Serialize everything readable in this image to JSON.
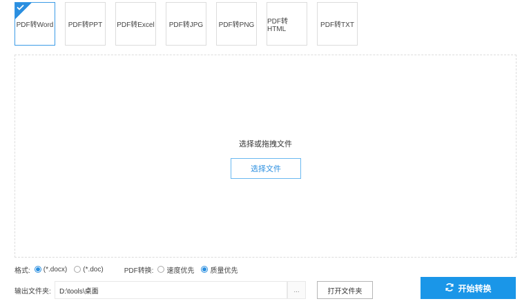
{
  "tabs": [
    {
      "label": "PDF转Word",
      "active": true
    },
    {
      "label": "PDF转PPT",
      "active": false
    },
    {
      "label": "PDF转Excel",
      "active": false
    },
    {
      "label": "PDF转JPG",
      "active": false
    },
    {
      "label": "PDF转PNG",
      "active": false
    },
    {
      "label": "PDF转HTML",
      "active": false
    },
    {
      "label": "PDF转TXT",
      "active": false
    }
  ],
  "dropzone": {
    "hint": "选择或拖拽文件",
    "select_button": "选择文件"
  },
  "format": {
    "label": "格式:",
    "options": [
      {
        "label": "(*.docx)",
        "checked": true
      },
      {
        "label": "(*.doc)",
        "checked": false
      }
    ]
  },
  "conversion": {
    "label": "PDF转换:",
    "options": [
      {
        "label": "速度优先",
        "checked": false
      },
      {
        "label": "质量优先",
        "checked": true
      }
    ]
  },
  "output": {
    "label": "输出文件夹:",
    "path": "D:\\tools\\桌面",
    "browse": "...",
    "open_folder": "打开文件夹"
  },
  "start_button": "开始转换",
  "colors": {
    "accent": "#2b8fe0",
    "start_bg": "#1a96e8"
  }
}
